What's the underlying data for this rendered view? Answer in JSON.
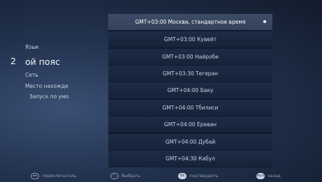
{
  "menu": {
    "index": "2",
    "items": [
      "Язык",
      "ой пояс",
      "Сеть",
      "Место нахожде",
      "Запуск по умо"
    ]
  },
  "timezones": [
    "GMT+03:00  Москва, стандартное время",
    "GMT+03:00  Кувейт",
    "GMT+03:00  Найроби",
    "GMT+03:30  Тегеран",
    "GMT+04:00  Баку",
    "GMT+04:00  Тбилиси",
    "GMT+04:00  Ереван",
    "GMT+04:00  Дубай",
    "GMT+04:30  Кабул"
  ],
  "footer": {
    "switch_icon": "◂ ▸",
    "switch_label": "переключатель",
    "select_icon": "⌃⌄",
    "select_label": "Выбрать",
    "ok_icon": "OK",
    "ok_label": "подтвердить",
    "back_icon": "Back",
    "back_label": "назад"
  }
}
